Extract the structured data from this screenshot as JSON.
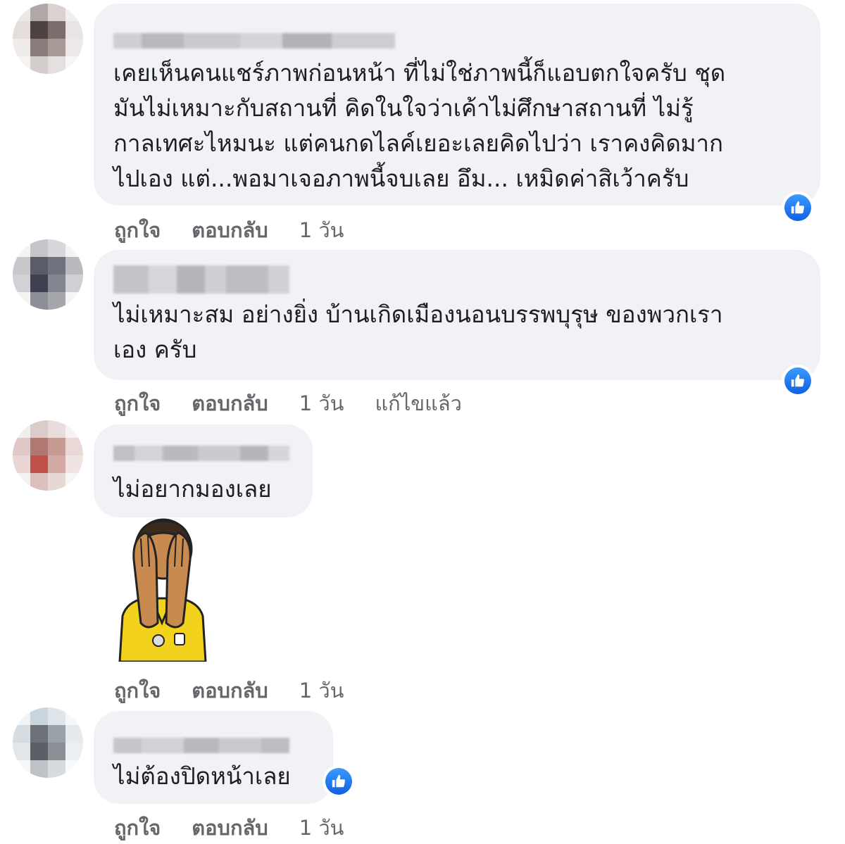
{
  "comments": [
    {
      "text": "เคยเห็นคนแชร์ภาพก่อนหน้า ที่ไม่ใช่ภาพนี้ก็แอบตกใจครับ ชุด\nมันไม่เหมาะกับสถานที่ คิดในใจว่าเค้าไม่ศึกษาสถานที่ ไม่รู้\nกาลเทศะไหมนะ แต่คนกดไลค์เยอะเลยคิดไปว่า เราคงคิดมาก\nไปเอง แต่...พอมาเจอภาพนี้จบเลย อึม... เหมิดค่าสิเว้าครับ",
      "like": "ถูกใจ",
      "reply": "ตอบกลับ",
      "time": "1 วัน"
    },
    {
      "text": "ไม่เหมาะสม อย่างยิ่ง บ้านเกิดเมืองนอนบรรพบุรุษ ของพวกเรา\nเอง ครับ",
      "like": "ถูกใจ",
      "reply": "ตอบกลับ",
      "time": "1 วัน",
      "edited": "แก้ไขแล้ว"
    },
    {
      "text": "ไม่อยากมองเลย",
      "like": "ถูกใจ",
      "reply": "ตอบกลับ",
      "time": "1 วัน",
      "sticker": "face-palm-sticker"
    },
    {
      "text": "ไม่ต้องปิดหน้าเลย",
      "like": "ถูกใจ",
      "reply": "ตอบกลับ",
      "time": "1 วัน"
    }
  ],
  "colors": {
    "bubble": "#f0f2f5",
    "meta_text": "#65676b",
    "like_blue": "#1877f2"
  },
  "icons": {
    "like_badge": "thumbs-up-icon"
  }
}
